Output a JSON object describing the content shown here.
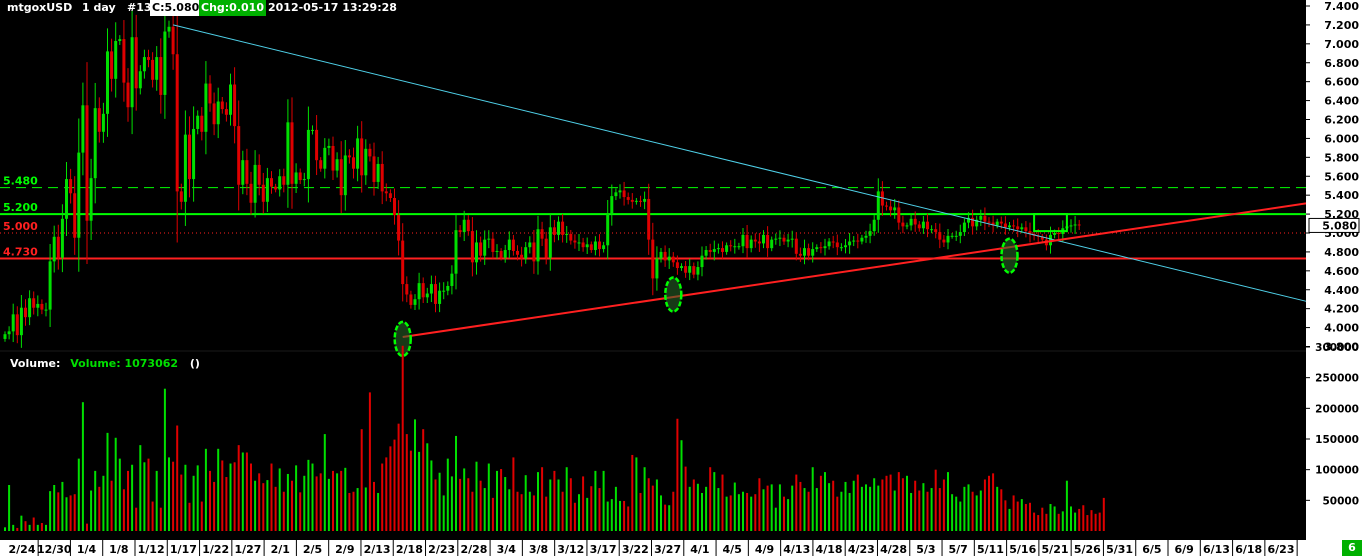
{
  "header": {
    "symbol": "mtgoxUSD",
    "period": "1 day",
    "bar_no": "#13",
    "close": "C:5.080",
    "change": "Chg:0.010",
    "datetime": "2012-05-17 13:29:28"
  },
  "volume_header": {
    "label": "Volume:",
    "value": "Volume: 1073062",
    "extra": "()"
  },
  "corner_badge": "6",
  "colors": {
    "up": "#00e000",
    "down": "#e00000",
    "trend_cyan": "#4fd0e8",
    "support_red": "#ff2020",
    "level_green": "#00ff00",
    "background": "#000000"
  },
  "chart_data": {
    "type": "candlestick",
    "price_axis": {
      "ticks": [
        "7.400",
        "7.200",
        "7.000",
        "6.800",
        "6.600",
        "6.400",
        "6.200",
        "6.000",
        "5.800",
        "5.600",
        "5.400",
        "5.200",
        "5.000",
        "4.800",
        "4.600",
        "4.400",
        "4.200",
        "4.000",
        "3.800"
      ],
      "range": [
        3.7,
        7.45
      ],
      "current": "5.080"
    },
    "volume_axis": {
      "ticks": [
        "300000",
        "250000",
        "200000",
        "150000",
        "100000",
        "50000"
      ],
      "range": [
        0,
        310000
      ]
    },
    "x_ticks": [
      "2/24",
      "12/30",
      "1/4",
      "1/8",
      "1/12",
      "1/17",
      "1/22",
      "1/27",
      "2/1",
      "2/5",
      "2/9",
      "2/13",
      "2/18",
      "2/23",
      "2/28",
      "3/4",
      "3/8",
      "3/12",
      "3/17",
      "3/22",
      "3/27",
      "4/1",
      "4/5",
      "4/9",
      "4/13",
      "4/18",
      "4/23",
      "4/28",
      "5/3",
      "5/7",
      "5/11",
      "5/16",
      "5/21",
      "5/26",
      "5/31",
      "6/5",
      "6/9",
      "6/13",
      "6/18",
      "6/23"
    ],
    "levels": [
      {
        "label": "5.480",
        "value": 5.48,
        "color": "#00ff00",
        "style": "dashed"
      },
      {
        "label": "5.200",
        "value": 5.2,
        "color": "#00ff00",
        "style": "solid"
      },
      {
        "label": "5.000",
        "value": 5.0,
        "color": "#ff2020",
        "style": "dotted"
      },
      {
        "label": "4.730",
        "value": 4.73,
        "color": "#ff2020",
        "style": "solid"
      }
    ],
    "trendlines": [
      {
        "color": "#4fd0e8",
        "from": {
          "bar": 41,
          "price": 7.2
        },
        "to": {
          "bar": 320,
          "price": 4.25
        }
      },
      {
        "color": "#ff2020",
        "from": {
          "bar": 97,
          "price": 3.9
        },
        "to": {
          "bar": 320,
          "price": 5.33
        }
      }
    ],
    "highlights": [
      {
        "shape": "ellipse",
        "bar": 97,
        "price": 3.88
      },
      {
        "shape": "ellipse",
        "bar": 163,
        "price": 4.35
      },
      {
        "shape": "ellipse",
        "bar": 245,
        "price": 4.76
      },
      {
        "shape": "rect",
        "bar_from": 251,
        "bar_to": 259,
        "price_low": 5.02,
        "price_high": 5.2
      }
    ],
    "closes": [
      3.93,
      3.96,
      4.14,
      3.92,
      4.21,
      4.11,
      4.31,
      4.21,
      4.25,
      4.19,
      4.19,
      4.7,
      4.96,
      4.74,
      5.15,
      5.57,
      5.42,
      4.95,
      5.85,
      6.35,
      5.13,
      5.58,
      6.32,
      6.07,
      6.26,
      6.92,
      6.63,
      7.03,
      7.05,
      6.59,
      6.33,
      7.07,
      6.53,
      6.71,
      6.86,
      6.83,
      6.62,
      6.86,
      6.46,
      7.13,
      7.18,
      6.89,
      5.44,
      5.33,
      6.04,
      5.57,
      6.1,
      6.24,
      6.07,
      6.58,
      6.37,
      6.15,
      6.39,
      6.31,
      6.25,
      6.57,
      6.13,
      5.51,
      5.77,
      5.52,
      5.32,
      5.72,
      5.51,
      5.33,
      5.58,
      5.49,
      5.46,
      5.6,
      5.51,
      6.17,
      5.52,
      5.64,
      5.56,
      5.57,
      6.09,
      6.09,
      5.77,
      5.68,
      5.9,
      5.92,
      5.66,
      5.78,
      5.4,
      5.82,
      5.8,
      5.68,
      6.0,
      5.61,
      5.89,
      5.81,
      5.54,
      5.73,
      5.44,
      5.42,
      5.37,
      5.19,
      4.92,
      4.46,
      4.35,
      4.24,
      4.3,
      4.47,
      4.32,
      4.36,
      4.46,
      4.25,
      4.39,
      4.39,
      4.44,
      4.57,
      5.03,
      5.01,
      5.14,
      5.02,
      4.69,
      4.9,
      4.76,
      4.93,
      4.94,
      4.8,
      4.81,
      4.74,
      4.82,
      4.93,
      4.81,
      4.77,
      4.73,
      4.85,
      4.9,
      4.7,
      5.04,
      4.94,
      4.74,
      5.06,
      4.98,
      5.12,
      4.98,
      4.99,
      4.92,
      4.9,
      4.9,
      4.85,
      4.88,
      4.82,
      4.91,
      4.83,
      4.87,
      5.2,
      5.39,
      5.43,
      5.45,
      5.38,
      5.35,
      5.33,
      5.34,
      5.33,
      5.36,
      4.93,
      4.52,
      4.73,
      4.8,
      4.71,
      4.75,
      4.69,
      4.63,
      4.65,
      4.58,
      4.65,
      4.56,
      4.64,
      4.76,
      4.82,
      4.8,
      4.83,
      4.84,
      4.8,
      4.87,
      4.86,
      4.86,
      4.86,
      4.98,
      4.84,
      4.93,
      4.91,
      4.89,
      4.98,
      4.84,
      4.93,
      4.94,
      4.95,
      4.91,
      4.93,
      4.94,
      4.78,
      4.76,
      4.84,
      4.76,
      4.83,
      4.85,
      4.84,
      4.86,
      4.91,
      4.9,
      4.85,
      4.85,
      4.87,
      4.91,
      4.92,
      4.91,
      4.95,
      4.97,
      5.02,
      5.14,
      5.44,
      5.29,
      5.28,
      5.24,
      5.27,
      5.11,
      5.07,
      5.08,
      5.15,
      5.09,
      5.05,
      5.12,
      5.04,
      5.04,
      5.01,
      4.93,
      4.9,
      4.97,
      4.97,
      4.97,
      5.01,
      5.11,
      5.16,
      5.07,
      5.14,
      5.18,
      5.12,
      5.11,
      5.08,
      5.12,
      5.1,
      5.06,
      5.08,
      5.07,
      5.04,
      5.06,
      5.02,
      4.99,
      4.97,
      4.96,
      4.93,
      4.87,
      4.98,
      5.0,
      4.99,
      5.05,
      5.07,
      5.08,
      5.09,
      5.08
    ],
    "volumes": [
      6000,
      75000,
      10000,
      5000,
      25000,
      16000,
      10000,
      22000,
      10000,
      13000,
      10000,
      65000,
      75000,
      63000,
      80000,
      55000,
      58000,
      60000,
      118000,
      210000,
      12000,
      66000,
      98000,
      72000,
      90000,
      160000,
      82000,
      152000,
      118000,
      68000,
      98000,
      108000,
      38000,
      140000,
      112000,
      118000,
      48000,
      98000,
      38000,
      232000,
      120000,
      113000,
      172000,
      92000,
      108000,
      46000,
      90000,
      107000,
      48000,
      134000,
      98000,
      80000,
      134000,
      115000,
      88000,
      110000,
      112000,
      140000,
      128000,
      128000,
      110000,
      82000,
      94000,
      78000,
      83000,
      110000,
      72000,
      102000,
      64000,
      93000,
      82000,
      107000,
      63000,
      90000,
      116000,
      110000,
      89000,
      94000,
      158000,
      85000,
      98000,
      94000,
      98000,
      103000,
      62000,
      64000,
      70000,
      166000,
      71000,
      226000,
      80000,
      62000,
      110000,
      120000,
      138000,
      149000,
      175000,
      302000,
      158000,
      131000,
      182000,
      129000,
      166000,
      143000,
      115000,
      84000,
      95000,
      58000,
      118000,
      89000,
      155000,
      85000,
      102000,
      86000,
      64000,
      113000,
      82000,
      70000,
      110000,
      54000,
      98000,
      101000,
      88000,
      68000,
      120000,
      64000,
      60000,
      91000,
      64000,
      58000,
      96000,
      104000,
      56000,
      84000,
      98000,
      84000,
      64000,
      104000,
      86000,
      46000,
      60000,
      89000,
      54000,
      73000,
      98000,
      70000,
      98000,
      48000,
      52000,
      72000,
      49000,
      49000,
      40000,
      124000,
      120000,
      62000,
      104000,
      86000,
      74000,
      84000,
      58000,
      43000,
      42000,
      64000,
      183000,
      148000,
      105000,
      72000,
      84000,
      77000,
      62000,
      72000,
      104000,
      96000,
      70000,
      92000,
      56000,
      58000,
      79000,
      60000,
      64000,
      62000,
      56000,
      60000,
      86000,
      68000,
      74000,
      76000,
      38000,
      76000,
      56000,
      52000,
      74000,
      92000,
      80000,
      70000,
      64000,
      104000,
      70000,
      90000,
      96000,
      78000,
      82000,
      56000,
      64000,
      80000,
      62000,
      82000,
      92000,
      72000,
      76000,
      72000,
      86000,
      74000,
      84000,
      90000,
      92000,
      66000,
      96000,
      86000,
      90000,
      62000,
      82000,
      66000,
      78000,
      64000,
      70000,
      100000,
      70000,
      84000,
      96000,
      60000,
      56000,
      48000,
      72000,
      76000,
      64000,
      58000,
      66000,
      84000,
      90000,
      94000,
      72000,
      68000,
      50000,
      36000,
      58000,
      48000,
      52000,
      44000,
      46000,
      30000,
      26000,
      38000,
      28000,
      44000,
      40000,
      28000,
      32000,
      82000,
      40000,
      30000,
      36000,
      42000,
      26000,
      34000,
      28000,
      30000,
      54000
    ]
  }
}
